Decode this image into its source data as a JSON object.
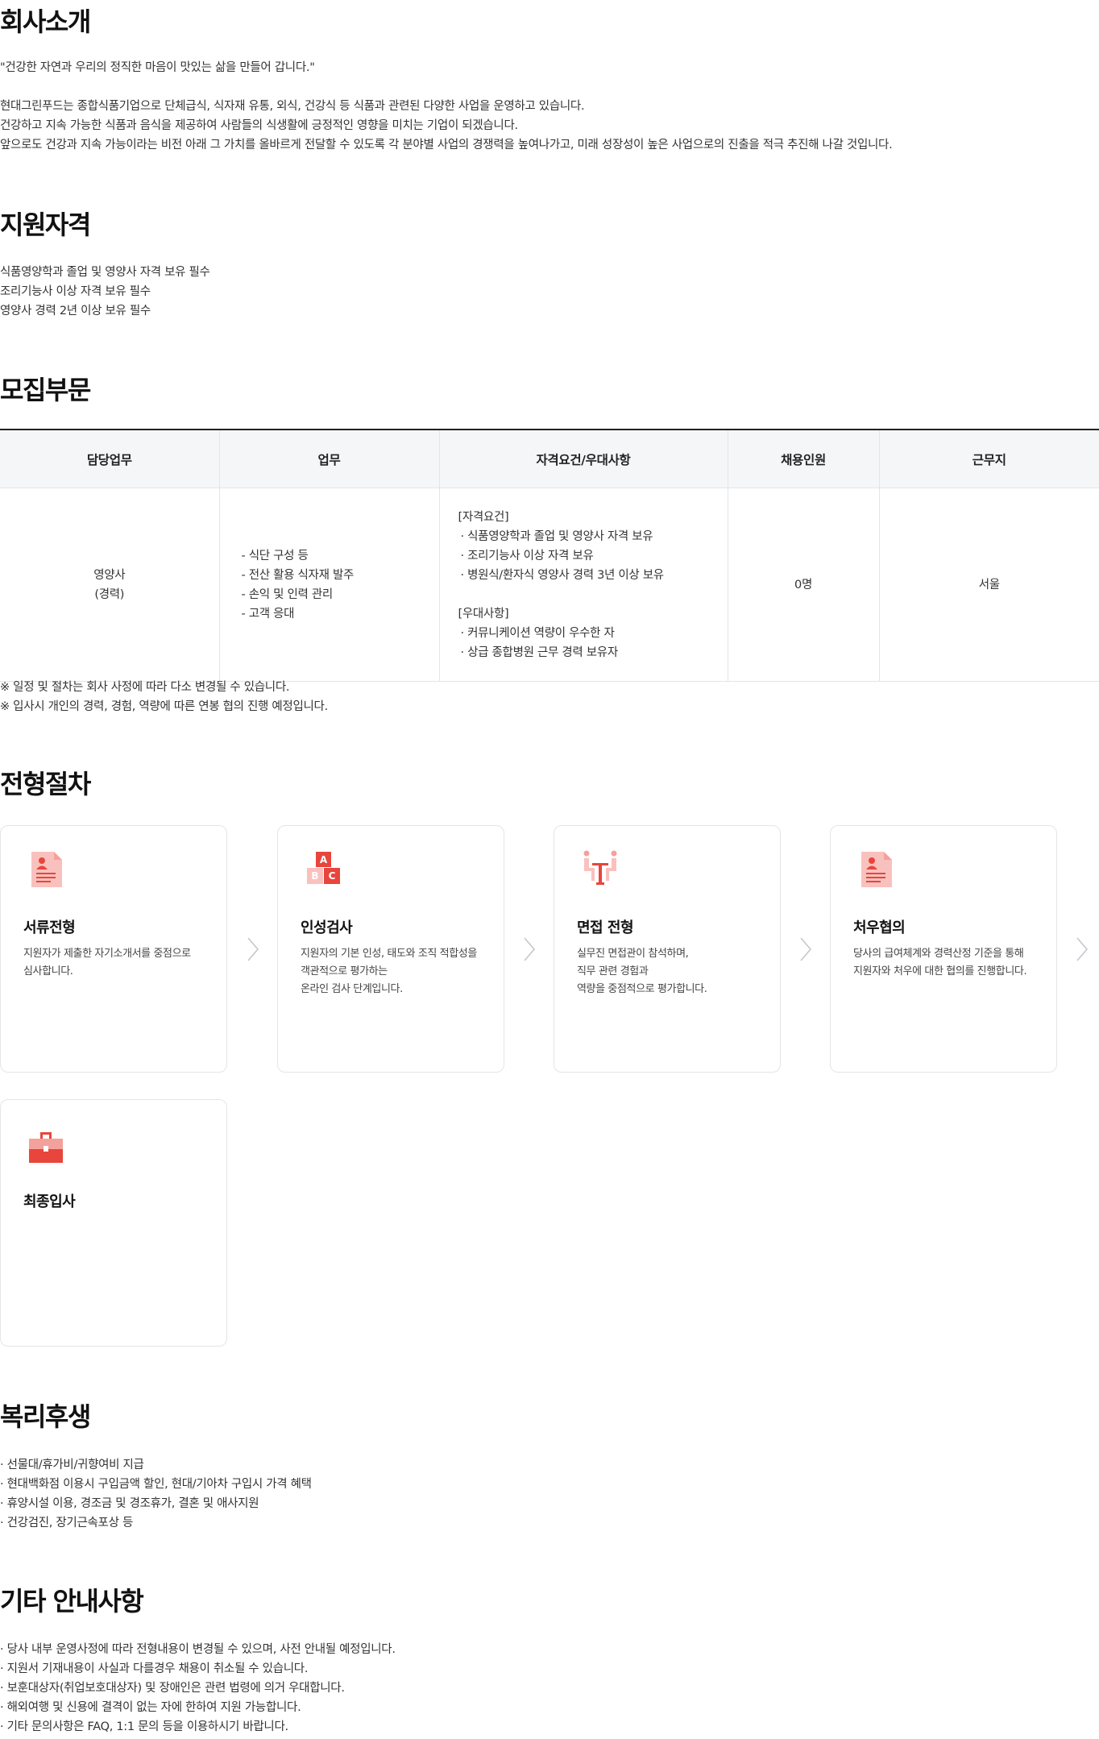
{
  "company": {
    "title": "회사소개",
    "slogan": "\"건강한 자연과 우리의 정직한 마음이 맛있는 삶을 만들어 갑니다.\"",
    "paragraphs": [
      "현대그린푸드는 종합식품기업으로 단체급식, 식자재 유통, 외식, 건강식 등 식품과 관련된 다양한 사업을 운영하고 있습니다.",
      "건강하고 지속 가능한 식품과 음식을 제공하여 사람들의 식생활에 긍정적인 영향을 미치는 기업이 되겠습니다.",
      "앞으로도 건강과 지속 가능이라는 비전 아래 그 가치를 올바르게 전달할 수 있도록 각 분야별 사업의 경쟁력을 높여나가고, 미래 성장성이 높은 사업으로의 진출을 적극 추진해 나갈 것입니다."
    ]
  },
  "qualification": {
    "title": "지원자격",
    "items": [
      "식품영양학과 졸업 및 영양사 자격 보유 필수",
      "조리기능사 이상 자격 보유 필수",
      "영양사 경력 2년 이상 보유 필수"
    ]
  },
  "recruit": {
    "title": "모집부문",
    "headers": [
      "담당업무",
      "업무",
      "자격요건/우대사항",
      "채용인원",
      "근무지"
    ],
    "row": {
      "role": "영양사",
      "role_sub": "(경력)",
      "duties": [
        "- 식단 구성 등",
        "- 전산 활용 식자재 발주",
        "- 손익 및 인력 관리",
        "- 고객 응대"
      ],
      "req_title": "[자격요건]",
      "req_items": [
        "· 식품영양학과 졸업 및 영양사 자격 보유",
        "· 조리기능사 이상 자격 보유",
        "· 병원식/환자식 영양사 경력 3년 이상 보유"
      ],
      "pref_title": "[우대사항]",
      "pref_items": [
        "· 커뮤니케이션 역량이 우수한 자",
        "· 상급 종합병원 근무 경력 보유자"
      ],
      "headcount": "0명",
      "location": "서울"
    },
    "notes": [
      "※ 일정 및 절차는 회사 사정에 따라 다소 변경될 수 있습니다.",
      "※ 입사시 개인의 경력, 경험, 역량에 따른 연봉 협의 진행 예정입니다."
    ]
  },
  "process": {
    "title": "전형절차",
    "steps": [
      {
        "name": "서류전형",
        "desc": "지원자가 제출한 자기소개서를 중점으로\n심사합니다.",
        "icon": "document-icon"
      },
      {
        "name": "인성검사",
        "desc": "지원자의 기본 인성, 태도와 조직 적합성을\n객관적으로 평가하는\n온라인 검사 단계입니다.",
        "icon": "abc-blocks-icon"
      },
      {
        "name": "면접 전형",
        "desc": "실무진 면접관이 참석하며,\n직무 관련 경험과\n역량을 중점적으로 평가합니다.",
        "icon": "interview-icon"
      },
      {
        "name": "처우협의",
        "desc": "당사의 급여체계와 경력산정 기준을 통해\n지원자와 처우에 대한 협의를 진행합니다.",
        "icon": "document-icon"
      },
      {
        "name": "최종입사",
        "desc": "",
        "icon": "briefcase-icon"
      }
    ]
  },
  "welfare": {
    "title": "복리후생",
    "items": [
      "· 선물대/휴가비/귀향여비 지급",
      "· 현대백화점 이용시 구입금액 할인, 현대/기아차 구입시 가격 혜택",
      "· 휴양시설 이용, 경조금 및 경조휴가, 결혼 및 애사지원",
      "· 건강검진, 장기근속포상 등"
    ]
  },
  "etc": {
    "title": "기타 안내사항",
    "items": [
      "· 당사 내부 운영사정에 따라 전형내용이 변경될 수 있으며, 사전 안내될 예정입니다.",
      "· 지원서 기재내용이 사실과 다를경우 채용이 취소될 수 있습니다.",
      "· 보훈대상자(취업보호대상자) 및 장애인은 관련 법령에 의거 우대합니다.",
      "· 해외여행 및 신용에 결격이 없는 자에 한하여 지원 가능합니다.",
      "· 기타 문의사항은 FAQ, 1:1 문의 등을 이용하시기 바랍니다."
    ]
  },
  "colors": {
    "accent_red": "#e8453c",
    "accent_light": "#f9c1bd",
    "border": "#e3e5e8",
    "header_bg": "#f5f6f8"
  }
}
